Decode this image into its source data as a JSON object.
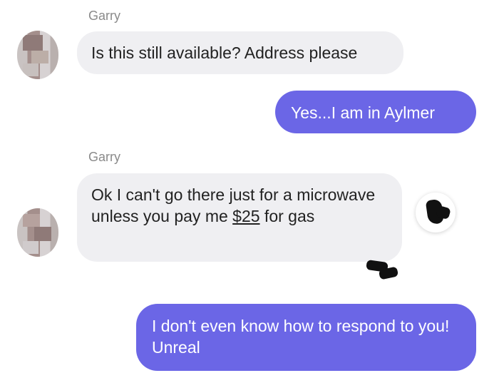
{
  "messages": [
    {
      "sender": "Garry",
      "text": "Is this still available? Address please"
    },
    {
      "outgoing_text": "Yes...I am in Aylmer"
    },
    {
      "sender": "Garry",
      "text_before": "Ok I can't go there just for a microwave unless you pay me ",
      "amount": "$25",
      "text_after": " for gas"
    },
    {
      "outgoing_text": "I don't even know how to respond to you! Unreal"
    }
  ],
  "colors": {
    "outgoing_bubble": "#6b66e6",
    "incoming_bubble": "#efeff2"
  },
  "icons": {
    "avatar": "pixelated-avatar",
    "redaction": "scribble-redaction"
  }
}
